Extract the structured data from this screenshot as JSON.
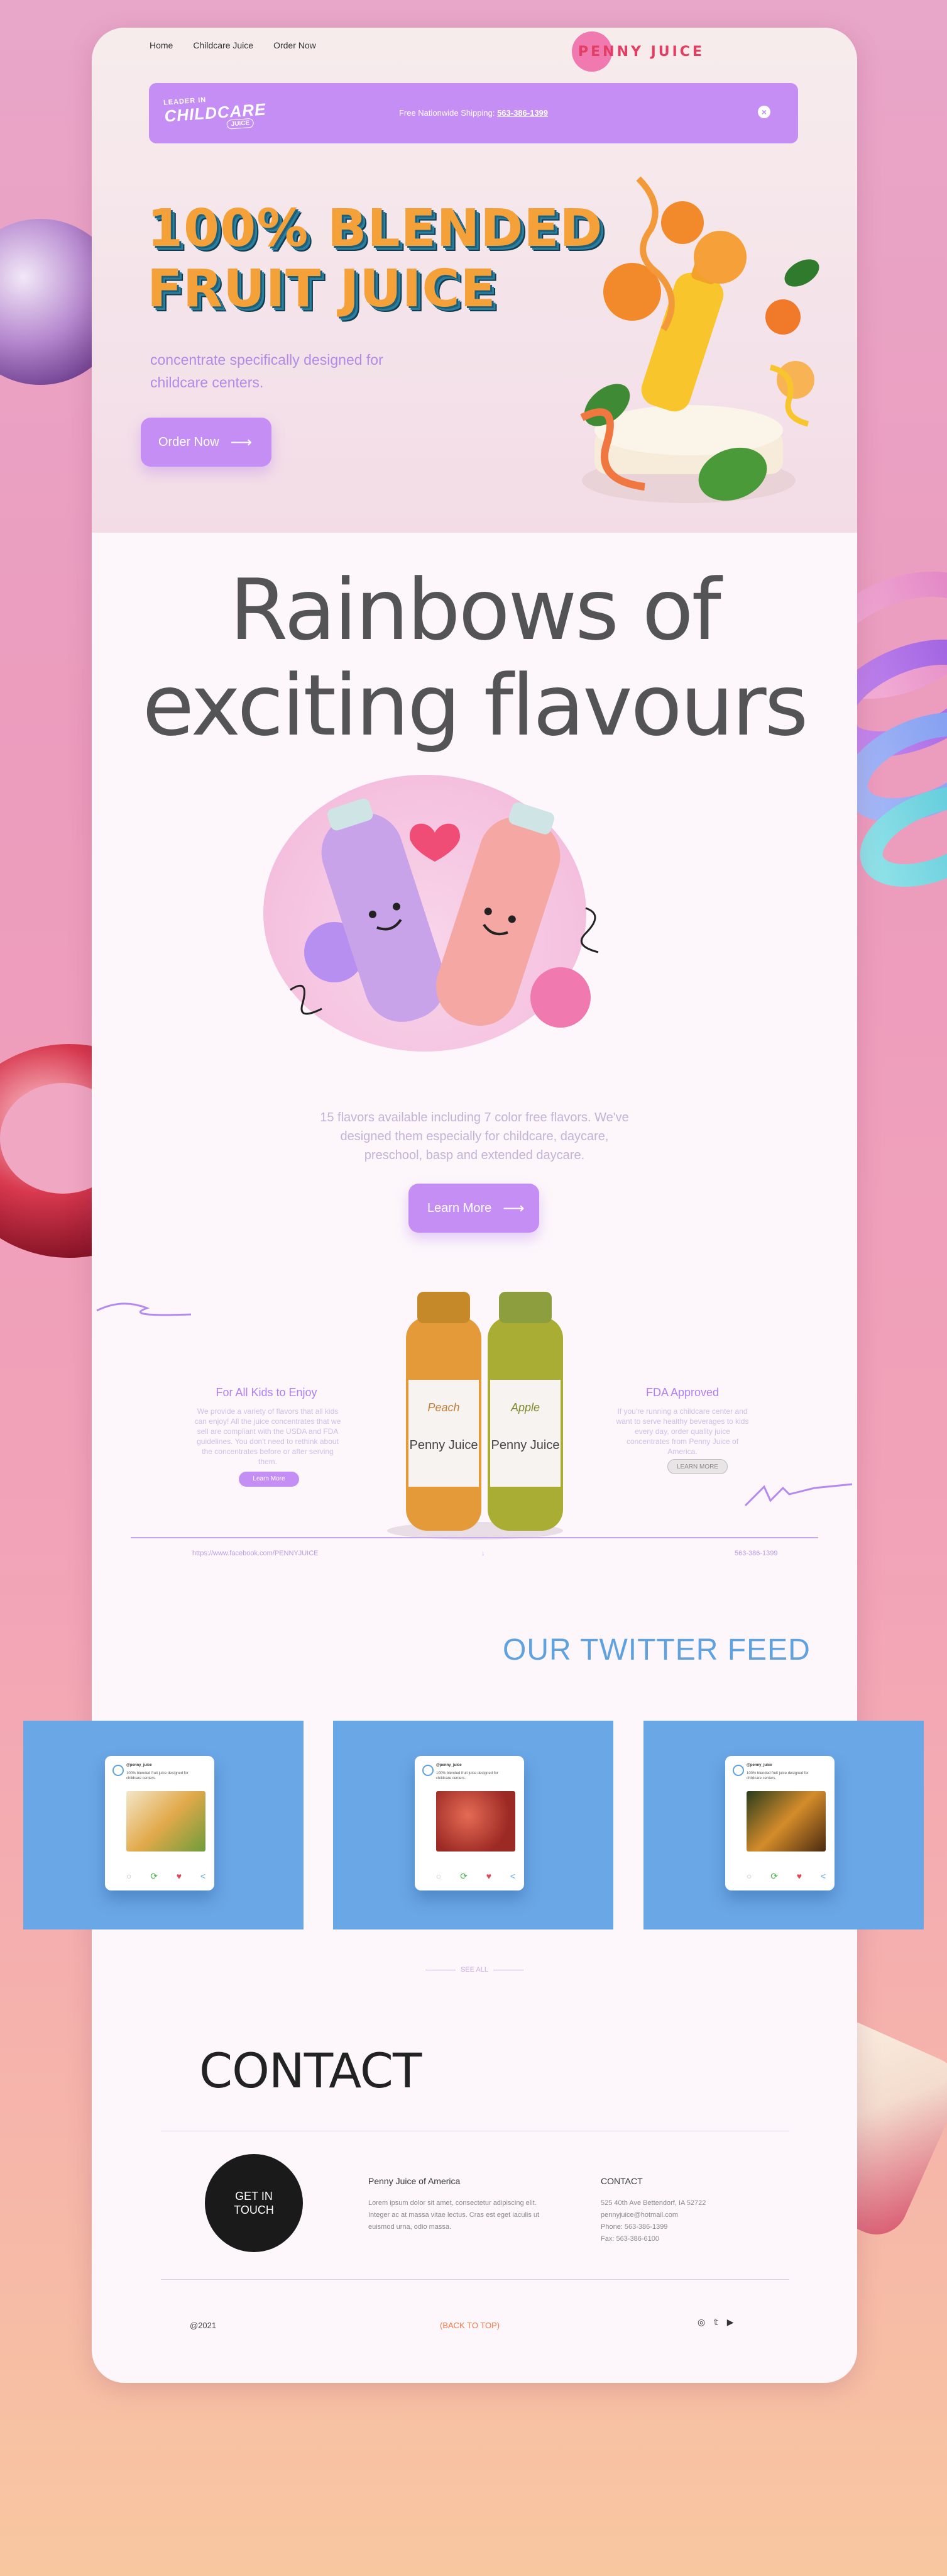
{
  "nav": {
    "items": [
      "Home",
      "Childcare Juice",
      "Order Now"
    ],
    "brand": "PENNY JUICE"
  },
  "banner": {
    "logo_line1": "LEADER IN",
    "logo_line2": "CHILDCARE",
    "logo_line3": "JUICE",
    "shipping_text": "Free Nationwide Shipping:",
    "phone": "563-386-1399"
  },
  "hero": {
    "title_line1": "100% BLENDED",
    "title_line2": "FRUIT JUICE",
    "subtitle": "concentrate specifically designed for childcare centers.",
    "button": "Order Now"
  },
  "flavours": {
    "heading_line1": "Rainbows of",
    "heading_line2": "exciting flavours",
    "description": "15 flavors available including 7 color free flavors. We've designed them especially for childcare, daycare, preschool, basp and extended daycare.",
    "button": "Learn More"
  },
  "features": {
    "left_title": "For All Kids to Enjoy",
    "left_text": "We provide a variety of flavors that all kids can enjoy! All the juice concentrates that we sell are compliant with the USDA and FDA guidelines. You don't need to rethink about the concentrates before or after serving them.",
    "left_button": "Learn More",
    "right_title": "FDA Approved",
    "right_text": "If you're running a childcare center and want to serve healthy beverages to kids every day, order quality juice concentrates from Penny Juice of America.",
    "right_button": "LEARN MORE",
    "bottle1_label": "Peach",
    "bottle2_label": "Apple",
    "bottle_brand": "Penny Juice"
  },
  "info_row": {
    "link": "https://www.facebook.com/PENNYJUICE",
    "phone": "563-386-1399"
  },
  "twitter": {
    "heading": "OUR TWITTER FEED",
    "cards": [
      {
        "name": "@penny_juice",
        "text": "100% blended fruit juice designed for childcare centers.",
        "link": "pennyjuice.com"
      },
      {
        "name": "@penny_juice",
        "text": "100% blended fruit juice designed for childcare centers.",
        "link": "pennyjuice.com"
      },
      {
        "name": "@penny_juice",
        "text": "100% blended fruit juice designed for childcare centers.",
        "link": "pennyjuice.com"
      }
    ],
    "see_all": "SEE ALL"
  },
  "contact": {
    "heading": "CONTACT",
    "circle_line1": "GET IN",
    "circle_line2": "TOUCH",
    "company_title": "Penny Juice of America",
    "company_text": "Lorem ipsum dolor sit amet, consectetur adipiscing elit. Integer ac at massa vitae lectus. Cras est eget iaculis ut euismod urna, odio massa.",
    "contact_title": "CONTACT",
    "address": "525 40th Ave Bettendorf, IA 52722",
    "email": "pennyjuice@hotmail.com",
    "phone": "Phone: 563-386-1399",
    "fax": "Fax: 563-386-6100"
  },
  "footer": {
    "copyright": "@2021",
    "back_to_top": "(BACK TO TOP)"
  },
  "colors": {
    "accent": "#c48ef5",
    "title_orange": "#f4a13a",
    "twitter_blue": "#5fa2df",
    "back_to_top": "#f07a4a"
  }
}
